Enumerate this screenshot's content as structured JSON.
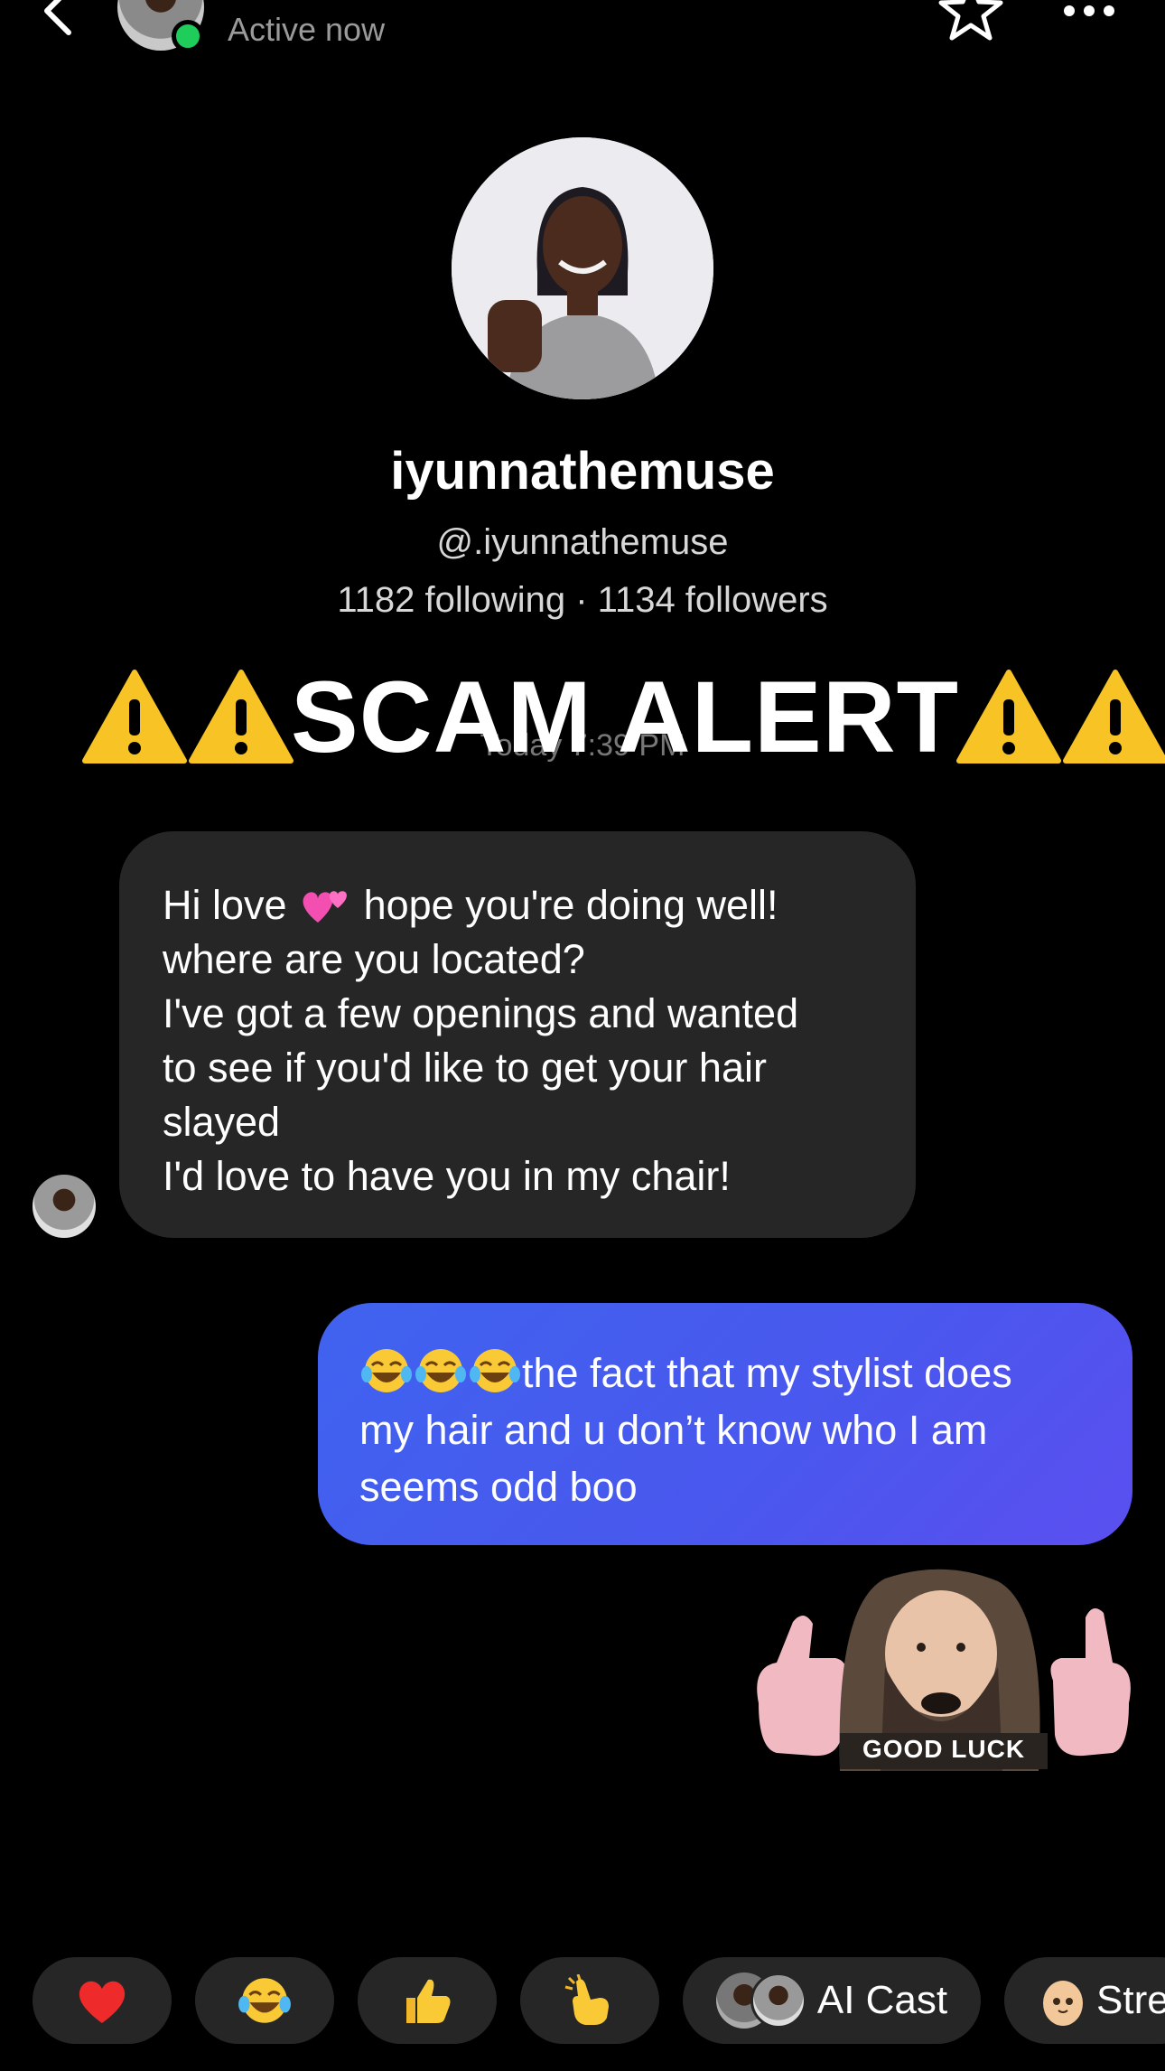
{
  "header": {
    "status": "Active now"
  },
  "profile": {
    "name": "iyunnathemuse",
    "handle": "@.iyunnathemuse",
    "stats": "1182 following · 1134 followers"
  },
  "overlay": {
    "scam_text": "SCAM ALERT"
  },
  "thread": {
    "timestamp": "Today 7:39 PM",
    "incoming": {
      "line1_a": "Hi love",
      "line1_b": "hope you're doing well!",
      "line2": "where are you located?",
      "line3": "I've got a few openings and wanted",
      "line4": "to see if you'd like to get your hair",
      "line5": "slayed",
      "line6": "I'd love to have you in my chair!"
    },
    "outgoing": {
      "line1": "the fact that my stylist does",
      "line2": "my hair and u don’t know who I am",
      "line3": "seems odd boo"
    },
    "sticker_caption": "GOOD LUCK"
  },
  "quick_replies": {
    "ai_cast": "AI Cast",
    "streak": "Stre"
  },
  "colors": {
    "background": "#000000",
    "incoming_bubble": "#262626",
    "outgoing_bubble": "#4a57ee",
    "online": "#1fce5a"
  }
}
